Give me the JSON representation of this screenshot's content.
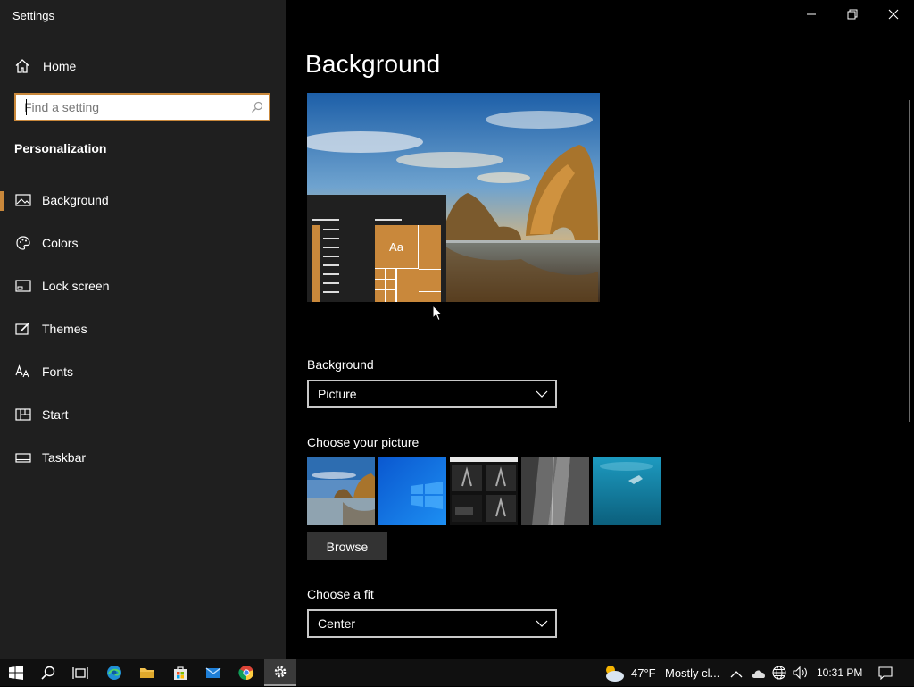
{
  "window": {
    "title": "Settings"
  },
  "sidebar": {
    "home_label": "Home",
    "search_placeholder": "Find a setting",
    "section_title": "Personalization",
    "items": [
      {
        "label": "Background",
        "icon": "picture-icon",
        "active": true
      },
      {
        "label": "Colors",
        "icon": "palette-icon"
      },
      {
        "label": "Lock screen",
        "icon": "lock-screen-icon"
      },
      {
        "label": "Themes",
        "icon": "brush-icon"
      },
      {
        "label": "Fonts",
        "icon": "fonts-icon"
      },
      {
        "label": "Start",
        "icon": "start-icon"
      },
      {
        "label": "Taskbar",
        "icon": "taskbar-icon"
      }
    ]
  },
  "main": {
    "title": "Background",
    "preview_tile_text": "Aa",
    "background_label": "Background",
    "background_value": "Picture",
    "choose_picture_label": "Choose your picture",
    "browse_label": "Browse",
    "fit_label": "Choose a fit",
    "fit_value": "Center"
  },
  "taskbar": {
    "weather_temp": "47°F",
    "weather_text": "Mostly cl...",
    "time": "10:31 PM"
  },
  "colors": {
    "accent": "#c9883b",
    "sidebar_bg": "#1f1f1f",
    "main_bg": "#000000"
  }
}
